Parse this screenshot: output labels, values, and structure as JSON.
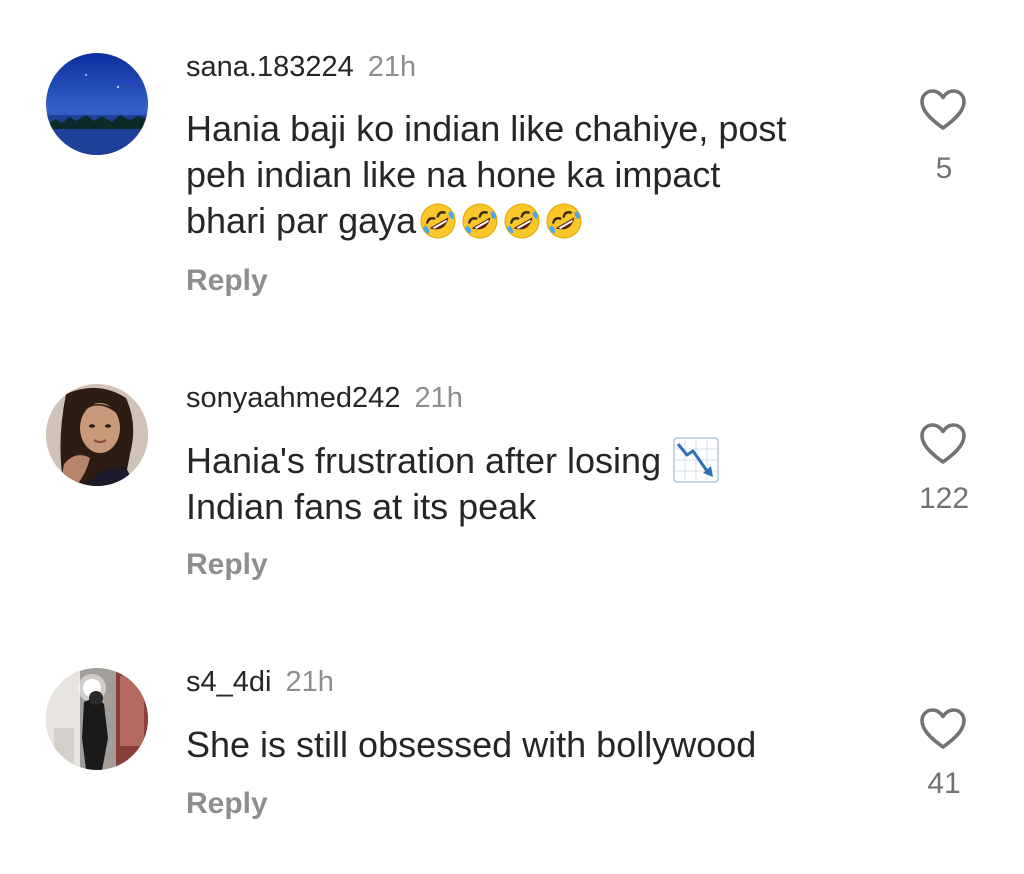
{
  "comments": [
    {
      "username": "sana.183224",
      "time": "21h",
      "text_lines": [
        "Hania baji ko indian  like chahiye, post",
        "peh indian like na hone ka impact",
        "bhari par gaya"
      ],
      "emojis": [
        "rolling-on-floor-laughing",
        "rolling-on-floor-laughing",
        "rolling-on-floor-laughing",
        "rolling-on-floor-laughing"
      ],
      "reply_label": "Reply",
      "like_count": "5"
    },
    {
      "username": "sonyaahmed242",
      "time": "21h",
      "text_lines": [
        "Hania's frustration after losing",
        "Indian fans at its peak"
      ],
      "inline_icon": "chart-decreasing-icon",
      "reply_label": "Reply",
      "like_count": "122"
    },
    {
      "username": "s4_4di",
      "time": "21h",
      "text_lines": [
        "She is still obsessed with bollywood"
      ],
      "reply_label": "Reply",
      "like_count": "41"
    }
  ],
  "icons": {
    "like": "heart-outline-icon"
  },
  "colors": {
    "text": "#262626",
    "muted": "#8e8e8e",
    "background": "#ffffff"
  }
}
